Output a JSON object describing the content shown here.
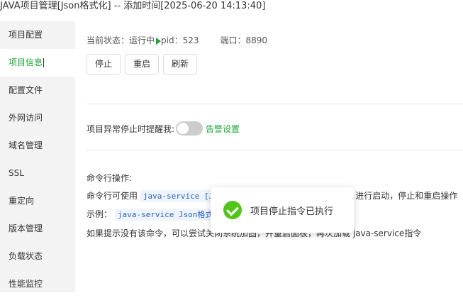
{
  "window": {
    "title": "JAVA项目管理[Json格式化] -- 添加时间[2025-06-20 14:13:40]"
  },
  "sidebar": {
    "items": [
      {
        "label": "项目配置"
      },
      {
        "label": "项目信息"
      },
      {
        "label": "配置文件"
      },
      {
        "label": "外网访问"
      },
      {
        "label": "域名管理"
      },
      {
        "label": "SSL"
      },
      {
        "label": "重定向"
      },
      {
        "label": "版本管理"
      },
      {
        "label": "负载状态"
      },
      {
        "label": "性能监控"
      }
    ],
    "active_index": 1
  },
  "status": {
    "state_label": "当前状态：运行中",
    "pid_label": "pid：523",
    "port_label": "端口：8890"
  },
  "actions": {
    "stop": "停止",
    "restart": "重启",
    "refresh": "刷新"
  },
  "alert": {
    "label": "项目异常停止时提醒我:",
    "link": "告警设置",
    "enabled": false
  },
  "commands": {
    "title": "命令行操作:",
    "line1_prefix": "命令行可使用",
    "line1_code": "java-service [J",
    "line1_suffix": "进行启动，停止和重启操作",
    "line2_prefix": "示例：",
    "line2_code": "java-service Json格式",
    "line3": "如果提示没有该命令，可以尝试关闭系统加固，并重启面板，再次加载 java-service指令"
  },
  "toast": {
    "message": "项目停止指令已执行"
  },
  "colors": {
    "accent": "#20a53a",
    "success": "#52c41a"
  }
}
